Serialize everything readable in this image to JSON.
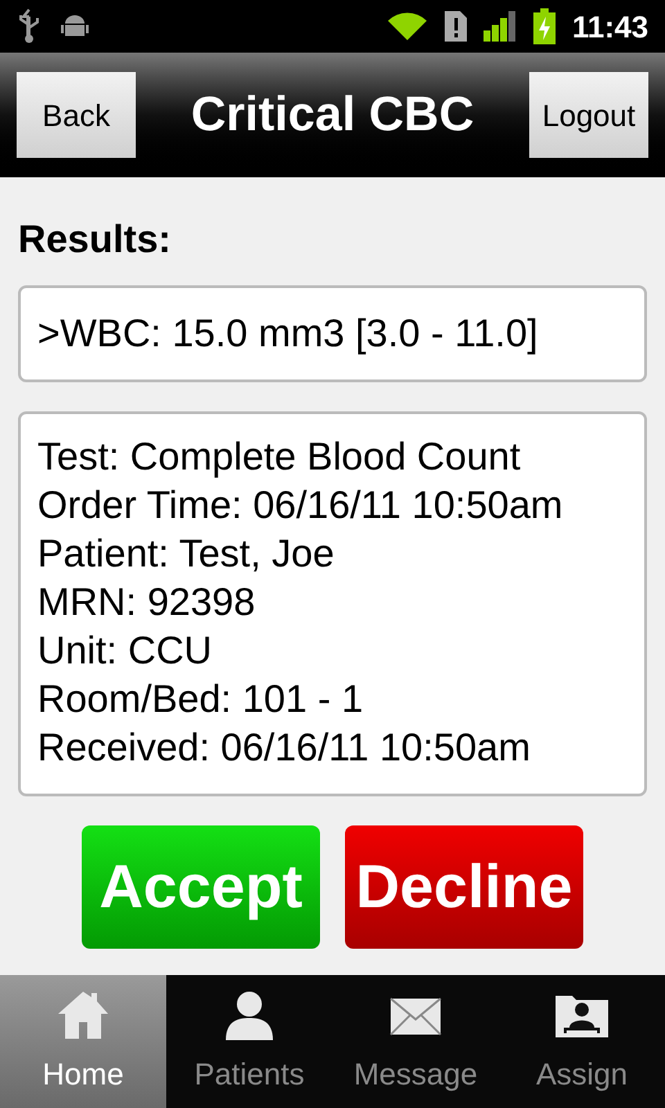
{
  "status_bar": {
    "time": "11:43"
  },
  "header": {
    "title": "Critical CBC",
    "back": "Back",
    "logout": "Logout"
  },
  "results_label": "Results:",
  "result": ">WBC: 15.0 mm3 [3.0 - 11.0]",
  "details": [
    "Test: Complete Blood Count",
    "Order Time: 06/16/11 10:50am",
    "Patient: Test, Joe",
    "MRN: 92398",
    "Unit: CCU",
    "Room/Bed: 101 - 1",
    "Received: 06/16/11 10:50am"
  ],
  "actions": [
    {
      "kind": "accept",
      "label": "Accept"
    },
    {
      "kind": "decline",
      "label": "Decline"
    }
  ],
  "tabs": [
    {
      "kind": "home",
      "label": "Home",
      "selected": true
    },
    {
      "kind": "patients",
      "label": "Patients",
      "selected": false
    },
    {
      "kind": "message",
      "label": "Message",
      "selected": false
    },
    {
      "kind": "assign",
      "label": "Assign",
      "selected": false
    }
  ]
}
